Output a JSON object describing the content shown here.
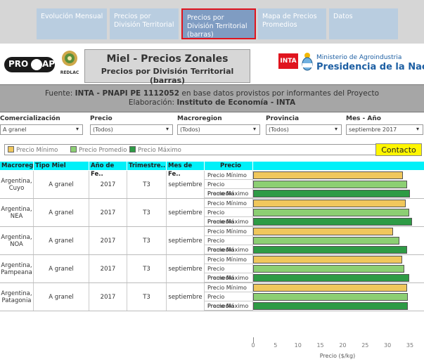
{
  "tabs": [
    {
      "label": "Evolución Mensual",
      "active": false
    },
    {
      "label": "Precios por División Territorial",
      "active": false
    },
    {
      "label": "Precios por División Territorial (barras)",
      "active": true
    },
    {
      "label": "Mapa de Precios Promedios",
      "active": false
    },
    {
      "label": "Datos",
      "active": false
    }
  ],
  "header": {
    "logo_left": "PRO API",
    "logo_redlac": "REDLAC",
    "title": "Miel - Precios Zonales",
    "subtitle": "Precios por División Territorial (barras)",
    "gov_logo": "INTA",
    "ministry": "Ministerio de Agroindustria",
    "presidency": "Presidencia de la Nación"
  },
  "source": {
    "line1_prefix": "Fuente: ",
    "line1_bold": "INTA - PNAPI PE 1112052",
    "line1_suffix": " en base datos provistos por informantes del Proyecto",
    "line2_prefix": "Elaboración: ",
    "line2_bold": "Instituto de Economía - INTA"
  },
  "filters": [
    {
      "label": "Comercialización",
      "value": "A granel"
    },
    {
      "label": "Precio",
      "value": "(Todos)"
    },
    {
      "label": "Macroregion",
      "value": "(Todos)"
    },
    {
      "label": "Provincia",
      "value": "(Todos)"
    },
    {
      "label": "Mes - Año",
      "value": "septiembre 2017"
    }
  ],
  "legend": {
    "items": [
      {
        "label": "Precio Mínimo",
        "color": "#f0c75c"
      },
      {
        "label": "Precio Promedio",
        "color": "#8ccf73"
      },
      {
        "label": "Precio Máximo",
        "color": "#2e9b45"
      }
    ]
  },
  "contact": {
    "label": "Contacto"
  },
  "table": {
    "headers": [
      "Macroreg..",
      "Tipo Miel",
      "Año de Fe..",
      "Trimestre..",
      "Mes de Fe..",
      "Precio"
    ],
    "price_rows": [
      "Precio Mínimo",
      "Precio Promedio",
      "Precio Máximo"
    ]
  },
  "chart_data": {
    "type": "bar",
    "orientation": "horizontal",
    "xlabel": "Precio ($/kg)",
    "xlim": [
      0,
      35
    ],
    "xticks": [
      0,
      5,
      10,
      15,
      20,
      25,
      30,
      35
    ],
    "groups": [
      {
        "region": "Argentina, Cuyo",
        "tipo": "A granel",
        "anio": "2017",
        "trimestre": "T3",
        "mes": "septiembre"
      },
      {
        "region": "Argentina, NEA",
        "tipo": "A granel",
        "anio": "2017",
        "trimestre": "T3",
        "mes": "septiembre"
      },
      {
        "region": "Argentina, NOA",
        "tipo": "A granel",
        "anio": "2017",
        "trimestre": "T3",
        "mes": "septiembre"
      },
      {
        "region": "Argentina, Pampeana",
        "tipo": "A granel",
        "anio": "2017",
        "trimestre": "T3",
        "mes": "septiembre"
      },
      {
        "region": "Argentina, Patagonia",
        "tipo": "A granel",
        "anio": "2017",
        "trimestre": "T3",
        "mes": "septiembre"
      }
    ],
    "series": [
      {
        "name": "Precio Mínimo",
        "color": "#f0c75c",
        "values": [
          33.5,
          34.0,
          31.2,
          33.2,
          34.3
        ]
      },
      {
        "name": "Precio Promedio",
        "color": "#8ccf73",
        "values": [
          34.3,
          34.8,
          32.7,
          33.8,
          34.5
        ]
      },
      {
        "name": "Precio Máximo",
        "color": "#2e9b45",
        "values": [
          35.0,
          35.5,
          34.3,
          34.8,
          34.5
        ]
      }
    ]
  }
}
